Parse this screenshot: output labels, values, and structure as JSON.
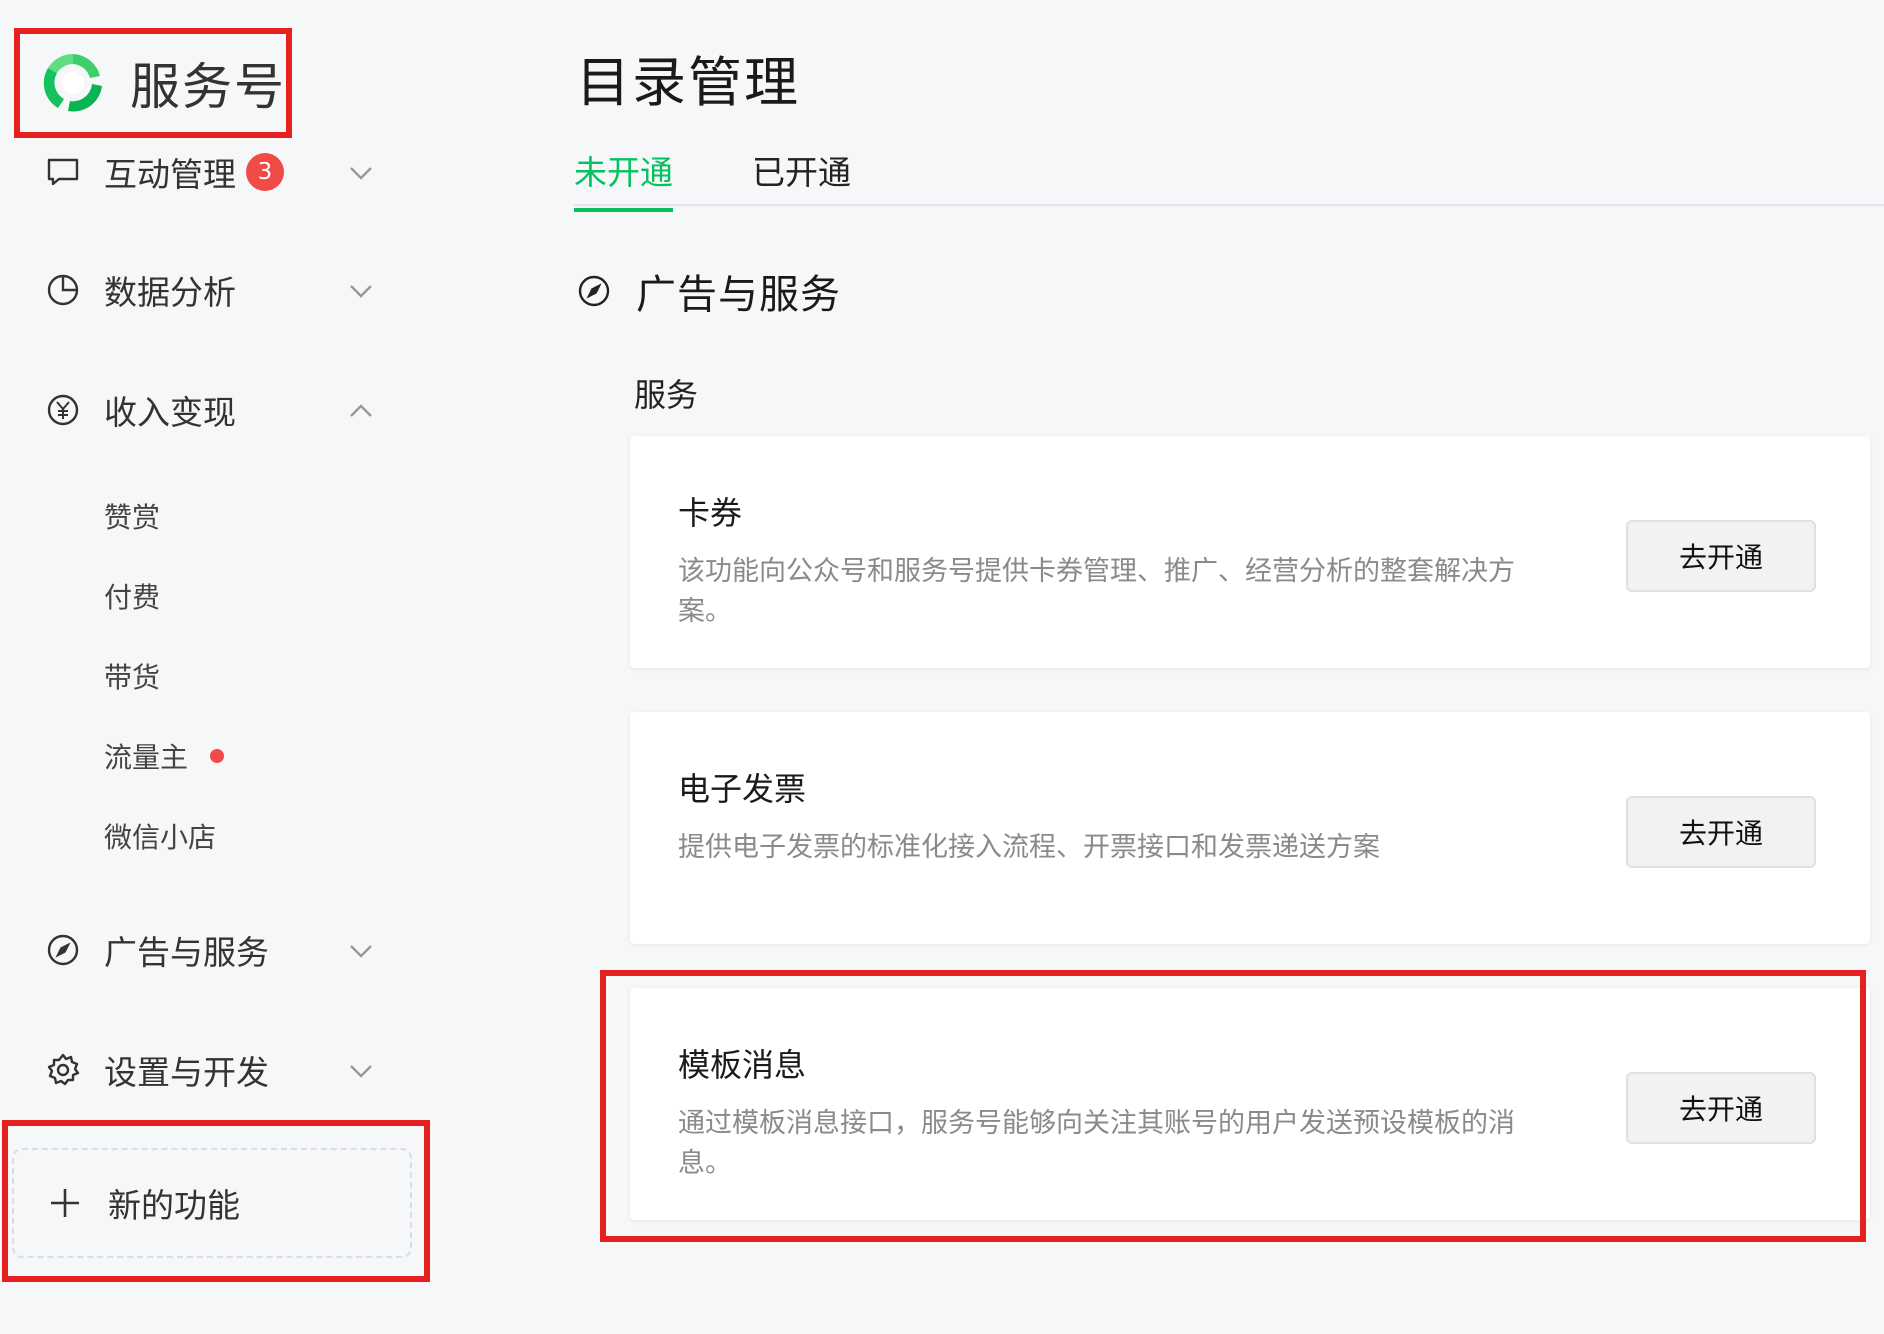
{
  "brand": {
    "name": "服务号"
  },
  "sidebar": {
    "items": [
      {
        "label": "互动管理",
        "badge": "3",
        "icon": "chat-icon",
        "expanded": false
      },
      {
        "label": "数据分析",
        "icon": "pie-chart-icon",
        "expanded": false
      },
      {
        "label": "收入变现",
        "icon": "yuan-icon",
        "expanded": true,
        "children": [
          "赞赏",
          "付费",
          "带货",
          "流量主",
          "微信小店"
        ]
      },
      {
        "label": "广告与服务",
        "icon": "compass-icon",
        "expanded": false
      },
      {
        "label": "设置与开发",
        "icon": "gear-icon",
        "expanded": false
      }
    ],
    "new_feature": "新的功能"
  },
  "main": {
    "title": "目录管理",
    "tabs": [
      {
        "label": "未开通",
        "active": true
      },
      {
        "label": "已开通",
        "active": false
      }
    ],
    "section": {
      "title": "广告与服务",
      "icon": "compass-icon"
    },
    "group_label": "服务",
    "cards": [
      {
        "title": "卡券",
        "desc": "该功能向公众号和服务号提供卡券管理、推广、经营分析的整套解决方案。",
        "button": "去开通"
      },
      {
        "title": "电子发票",
        "desc": "提供电子发票的标准化接入流程、开票接口和发票递送方案",
        "button": "去开通"
      },
      {
        "title": "模板消息",
        "desc": "通过模板消息接口，服务号能够向关注其账号的用户发送预设模板的消息。",
        "button": "去开通"
      }
    ]
  },
  "colors": {
    "accent": "#07c160",
    "badge": "#f04b46",
    "highlight": "#e62020"
  }
}
